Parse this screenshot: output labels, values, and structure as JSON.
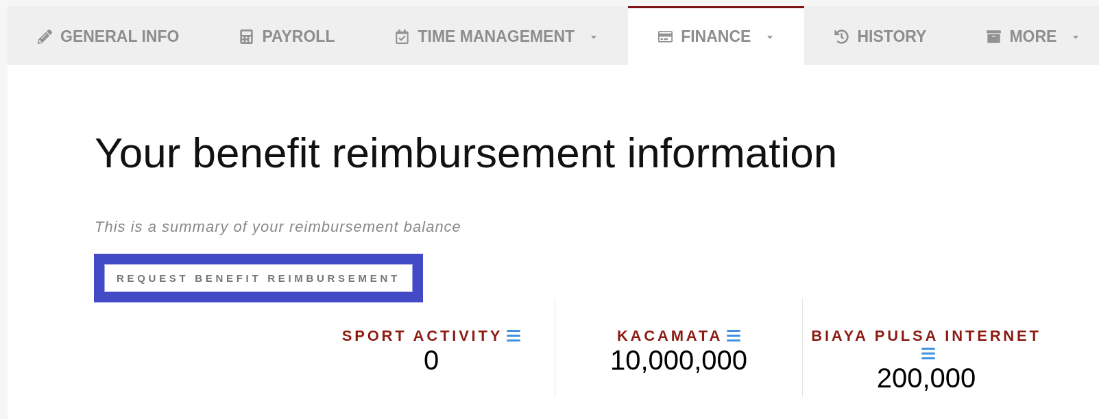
{
  "tabs": [
    {
      "label": "GENERAL INFO",
      "selected": false,
      "dropdown": false
    },
    {
      "label": "PAYROLL",
      "selected": false,
      "dropdown": false
    },
    {
      "label": "TIME MANAGEMENT",
      "selected": false,
      "dropdown": true
    },
    {
      "label": "FINANCE",
      "selected": true,
      "dropdown": true
    },
    {
      "label": "HISTORY",
      "selected": false,
      "dropdown": false
    },
    {
      "label": "MORE",
      "selected": false,
      "dropdown": true
    }
  ],
  "heading": "Your benefit reimbursement information",
  "summary": "This is a summary of your reimbursement balance",
  "request_button": {
    "label": "REQUEST BENEFIT REIMBURSEMENT",
    "focused": true
  },
  "benefits": [
    {
      "label": "SPORT ACTIVITY",
      "amount": "0"
    },
    {
      "label": "KACAMATA",
      "amount": "10,000,000"
    },
    {
      "label": "BIAYA PULSA INTERNET",
      "amount": "200,000"
    }
  ]
}
